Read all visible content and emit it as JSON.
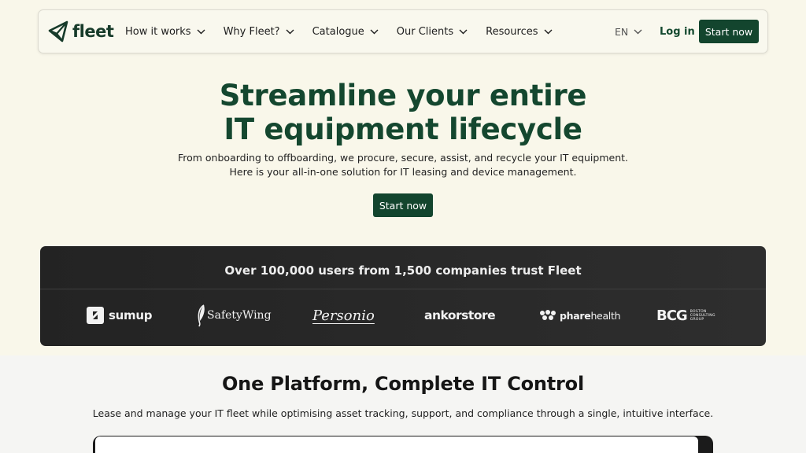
{
  "brand": {
    "name": "fleet",
    "color": "#13452e"
  },
  "nav": {
    "items": [
      {
        "label": "How it works"
      },
      {
        "label": "Why Fleet?"
      },
      {
        "label": "Catalogue"
      },
      {
        "label": "Our Clients"
      },
      {
        "label": "Resources"
      }
    ],
    "language": "EN",
    "login_label": "Log in",
    "start_label": "Start now"
  },
  "hero": {
    "title_line1": "Streamline your entire",
    "title_line2": "IT equipment lifecycle",
    "subtitle": "From onboarding to offboarding, we procure, secure, assist, and recycle your IT equipment. Here is your all-in-one solution for IT leasing and device management.",
    "cta_label": "Start now"
  },
  "trust": {
    "title": "Over 100,000 users from 1,500 companies trust Fleet",
    "logos": {
      "sumup": "sumup",
      "safetywing": "SafetyWing",
      "personio": "Personio",
      "ankorstore": "ankorstore",
      "phare_bold": "phare",
      "phare_rest": "health",
      "bcg": "BCG",
      "bcg_line1": "BOSTON",
      "bcg_line2": "CONSULTING",
      "bcg_line3": "GROUP"
    }
  },
  "platform": {
    "title": "One Platform, Complete IT Control",
    "subtitle": "Lease and manage your IT fleet while optimising asset tracking, support, and compliance through a single, intuitive interface."
  },
  "colors": {
    "hero_bg": "#f9f7ea",
    "accent": "#13452e",
    "title_green": "#14472f",
    "band_dark": "#262626"
  },
  "icons": {
    "logo": "paper-plane-icon",
    "chevron": "chevron-down-icon"
  }
}
